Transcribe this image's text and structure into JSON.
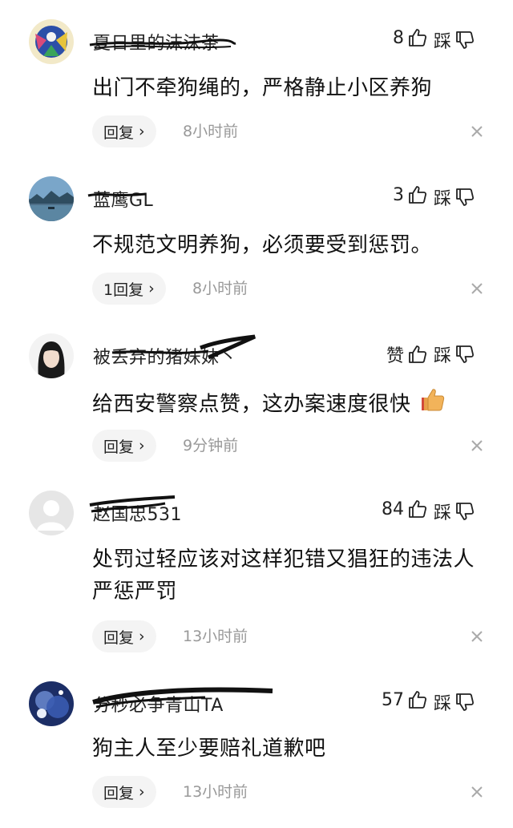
{
  "colors": {
    "text": "#111111",
    "muted": "#999999",
    "reply_bg": "#f4f4f4"
  },
  "dislike_label": "踩",
  "comments": [
    {
      "username": "夏日里的沫沫茶",
      "likes": "8",
      "text": "出门不牵狗绳的，严格静止小区养狗",
      "reply_label": "回复",
      "time": "8小时前"
    },
    {
      "username": "蓝鹰GL",
      "likes": "3",
      "text": "不规范文明养狗，必须要受到惩罚。",
      "reply_label": "1回复",
      "time": "8小时前"
    },
    {
      "username": "被丢弃的猪妹妹丶",
      "likes": "赞",
      "text": "给西安警察点赞，这办案速度很快",
      "reply_label": "回复",
      "time": "9分钟前"
    },
    {
      "username": "赵国忠531",
      "likes": "84",
      "text": "处罚过轻应该对这样犯错又猖狂的违法人严惩严罚",
      "reply_label": "回复",
      "time": "13小时前"
    },
    {
      "username": "分秒必争青山TA",
      "likes": "57",
      "text": "狗主人至少要赔礼道歉吧",
      "reply_label": "回复",
      "time": "13小时前"
    }
  ]
}
